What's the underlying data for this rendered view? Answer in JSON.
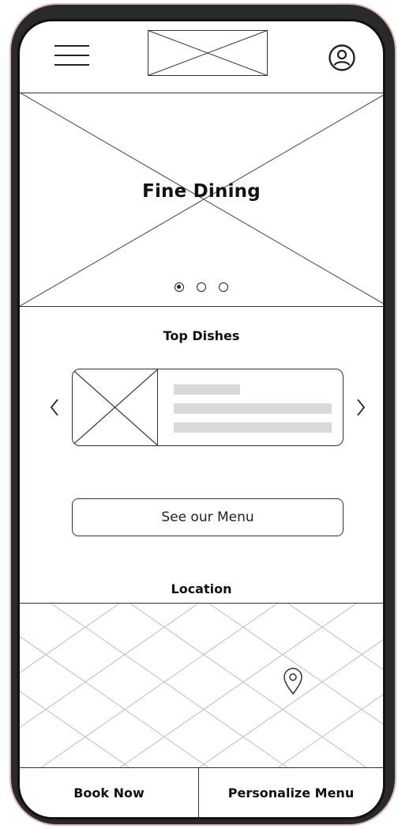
{
  "hero": {
    "title": "Fine Dining",
    "slides": 3,
    "active_slide": 1
  },
  "top_dishes": {
    "title": "Top Dishes"
  },
  "menu_button": {
    "label": "See our Menu"
  },
  "location": {
    "title": "Location"
  },
  "bottom_bar": {
    "book_label": "Book Now",
    "personalize_label": "Personalize Menu"
  },
  "icons": {
    "menu": "hamburger-icon",
    "profile": "user-circle-icon",
    "prev": "chevron-left-icon",
    "next": "chevron-right-icon",
    "pin": "map-pin-icon"
  }
}
